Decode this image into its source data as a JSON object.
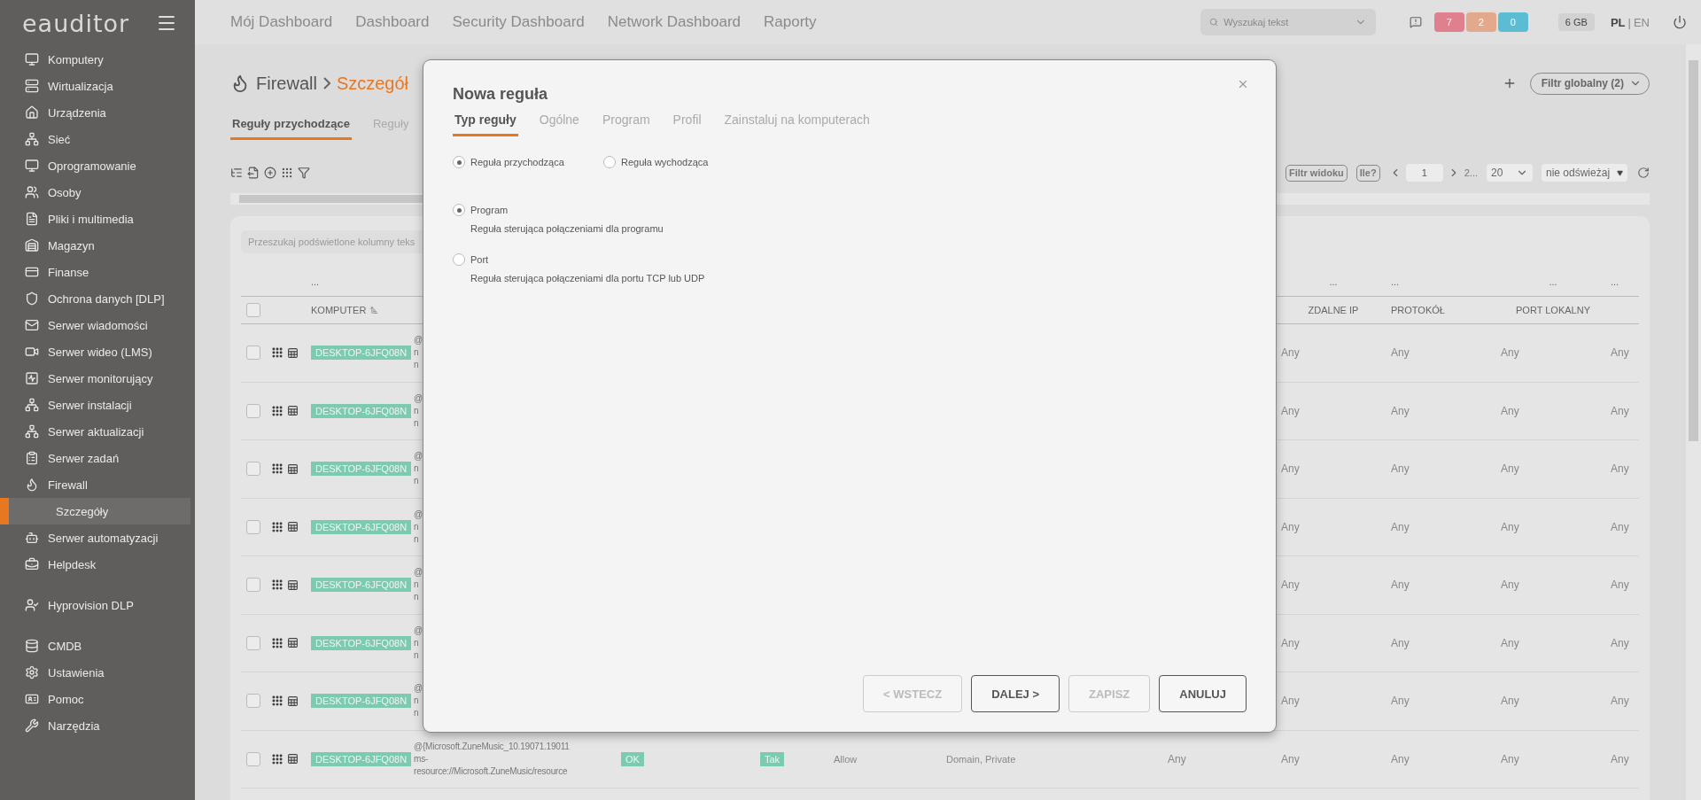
{
  "sidebar": {
    "logo": "eauditor",
    "groups": [
      [
        {
          "label": "Komputery",
          "selected": false
        },
        {
          "label": "Wirtualizacja",
          "selected": false
        },
        {
          "label": "Urządzenia",
          "selected": false
        },
        {
          "label": "Sieć",
          "selected": false
        },
        {
          "label": "Oprogramowanie",
          "selected": false
        },
        {
          "label": "Osoby",
          "selected": false
        },
        {
          "label": "Pliki i multimedia",
          "selected": false
        },
        {
          "label": "Magazyn",
          "selected": false
        },
        {
          "label": "Finanse",
          "selected": false
        },
        {
          "label": "Ochrona danych [DLP]",
          "selected": false
        },
        {
          "label": "Serwer wiadomości",
          "selected": false
        },
        {
          "label": "Serwer wideo (LMS)",
          "selected": false
        },
        {
          "label": "Serwer monitorujący",
          "selected": false
        },
        {
          "label": "Serwer instalacji",
          "selected": false
        },
        {
          "label": "Serwer aktualizacji",
          "selected": false
        },
        {
          "label": "Serwer zadań",
          "selected": false
        },
        {
          "label": "Firewall",
          "selected": false,
          "expanded": true,
          "children": [
            {
              "label": "Szczegóły",
              "selected": true
            }
          ]
        },
        {
          "label": "Serwer automatyzacji",
          "selected": false
        },
        {
          "label": "Helpdesk",
          "selected": false
        }
      ],
      [
        {
          "label": "Hyprovision DLP",
          "selected": false
        }
      ],
      [
        {
          "label": "CMDB",
          "selected": false
        },
        {
          "label": "Ustawienia",
          "selected": false
        },
        {
          "label": "Pomoc",
          "selected": false
        },
        {
          "label": "Narzędzia",
          "selected": false
        }
      ]
    ]
  },
  "topnav": {
    "links": [
      "Mój Dashboard",
      "Dashboard",
      "Security Dashboard",
      "Network Dashboard",
      "Raporty"
    ],
    "search": {
      "placeholder": "Wyszukaj tekst"
    },
    "badges": [
      {
        "count": "7",
        "color": "#e0808f"
      },
      {
        "count": "2",
        "color": "#e3a98d"
      },
      {
        "count": "0",
        "color": "#5cbcd4"
      }
    ],
    "memory": "6 GB",
    "languages": [
      {
        "label": "PL",
        "selected": true
      },
      {
        "label": "EN",
        "selected": false
      }
    ],
    "language_separator": "|"
  },
  "page": {
    "breadcrumb": [
      "Firewall",
      "Szczegół"
    ],
    "global_filter": "Filtr globalny (2)",
    "tabs": [
      {
        "label": "Reguły przychodzące",
        "selected": true
      },
      {
        "label": "Reguły",
        "selected": false
      }
    ],
    "view_filter": "Filtr widoku",
    "count_button": "Ile?",
    "pagination": {
      "page": "1",
      "total": "2...",
      "page_size": "20",
      "refresh": "nie odświeżaj"
    },
    "table": {
      "search_placeholder": "Przeszukaj podświetlone kolumny teks",
      "all_checked": false,
      "columns": [
        {
          "label": "KOMPUTER",
          "filter": "...",
          "sorted": true
        },
        {
          "label": "ZDALNE IP",
          "filter": "..."
        },
        {
          "label": "PROTOKÓŁ",
          "filter": "..."
        },
        {
          "label": "PORT LOKALNY",
          "filter": "..."
        },
        {
          "filter": "..."
        }
      ],
      "rows": [
        {
          "checked": false,
          "komputer": "DESKTOP-6JFQ08N",
          "column_4": [
            "@",
            "n",
            "n"
          ],
          "zdalne_ip": "Any",
          "protokol": "Any",
          "port_lokalny": "Any",
          "column_13": "Any"
        },
        {
          "checked": false,
          "komputer": "DESKTOP-6JFQ08N",
          "column_4": [
            "@",
            "n",
            "n"
          ],
          "zdalne_ip": "Any",
          "protokol": "Any",
          "port_lokalny": "Any",
          "column_13": "Any"
        },
        {
          "checked": false,
          "komputer": "DESKTOP-6JFQ08N",
          "column_4": [
            "@",
            "n",
            "n"
          ],
          "zdalne_ip": "Any",
          "protokol": "Any",
          "port_lokalny": "Any",
          "column_13": "Any"
        },
        {
          "checked": false,
          "komputer": "DESKTOP-6JFQ08N",
          "column_4": [
            "@",
            "n",
            "n"
          ],
          "zdalne_ip": "Any",
          "protokol": "Any",
          "port_lokalny": "Any",
          "column_13": "Any"
        },
        {
          "checked": false,
          "komputer": "DESKTOP-6JFQ08N",
          "column_4": [
            "@",
            "n",
            "n"
          ],
          "zdalne_ip": "Any",
          "protokol": "Any",
          "port_lokalny": "Any",
          "column_13": "Any"
        },
        {
          "checked": false,
          "komputer": "DESKTOP-6JFQ08N",
          "column_4": [
            "@",
            "n",
            "n"
          ],
          "zdalne_ip": "Any",
          "protokol": "Any",
          "port_lokalny": "Any",
          "column_13": "Any"
        },
        {
          "checked": false,
          "komputer": "DESKTOP-6JFQ08N",
          "column_4": [
            "@",
            "n",
            "n"
          ],
          "zdalne_ip": "Any",
          "protokol": "Any",
          "port_lokalny": "Any",
          "column_13": "Any"
        },
        {
          "checked": false,
          "komputer": "DESKTOP-6JFQ08N",
          "column_4": [
            "@{Microsoft.ZuneMusic_10.19071.19011",
            "ms-",
            "resource://Microsoft.ZuneMusic/resource"
          ],
          "column_5": "OK",
          "column_6": "Tak",
          "column_7": "Allow",
          "column_8": "Domain, Private",
          "column_9": "Any",
          "zdalne_ip": "Any",
          "protokol": "Any",
          "port_lokalny": "Any",
          "column_13": "Any"
        }
      ]
    }
  },
  "dialog": {
    "title": "Nowa reguła",
    "tabs": [
      {
        "label": "Typ reguły",
        "selected": true
      },
      {
        "label": "Ogólne",
        "selected": false
      },
      {
        "label": "Program",
        "selected": false
      },
      {
        "label": "Profil",
        "selected": false
      },
      {
        "label": "Zainstaluj na komputerach",
        "selected": false
      }
    ],
    "direction": [
      {
        "label": "Reguła przychodząca",
        "selected": true
      },
      {
        "label": "Reguła wychodząca",
        "selected": false
      }
    ],
    "rule_types": [
      {
        "label": "Program",
        "description": "Reguła sterująca połączeniami dla programu",
        "selected": true
      },
      {
        "label": "Port",
        "description": "Reguła sterująca połączeniami dla portu TCP lub UDP",
        "selected": false
      }
    ],
    "buttons": [
      {
        "label": "< WSTECZ",
        "disabled": true
      },
      {
        "label": "DALEJ >",
        "disabled": false
      },
      {
        "label": "ZAPISZ",
        "disabled": true
      },
      {
        "label": "ANULUJ",
        "disabled": false
      }
    ]
  }
}
